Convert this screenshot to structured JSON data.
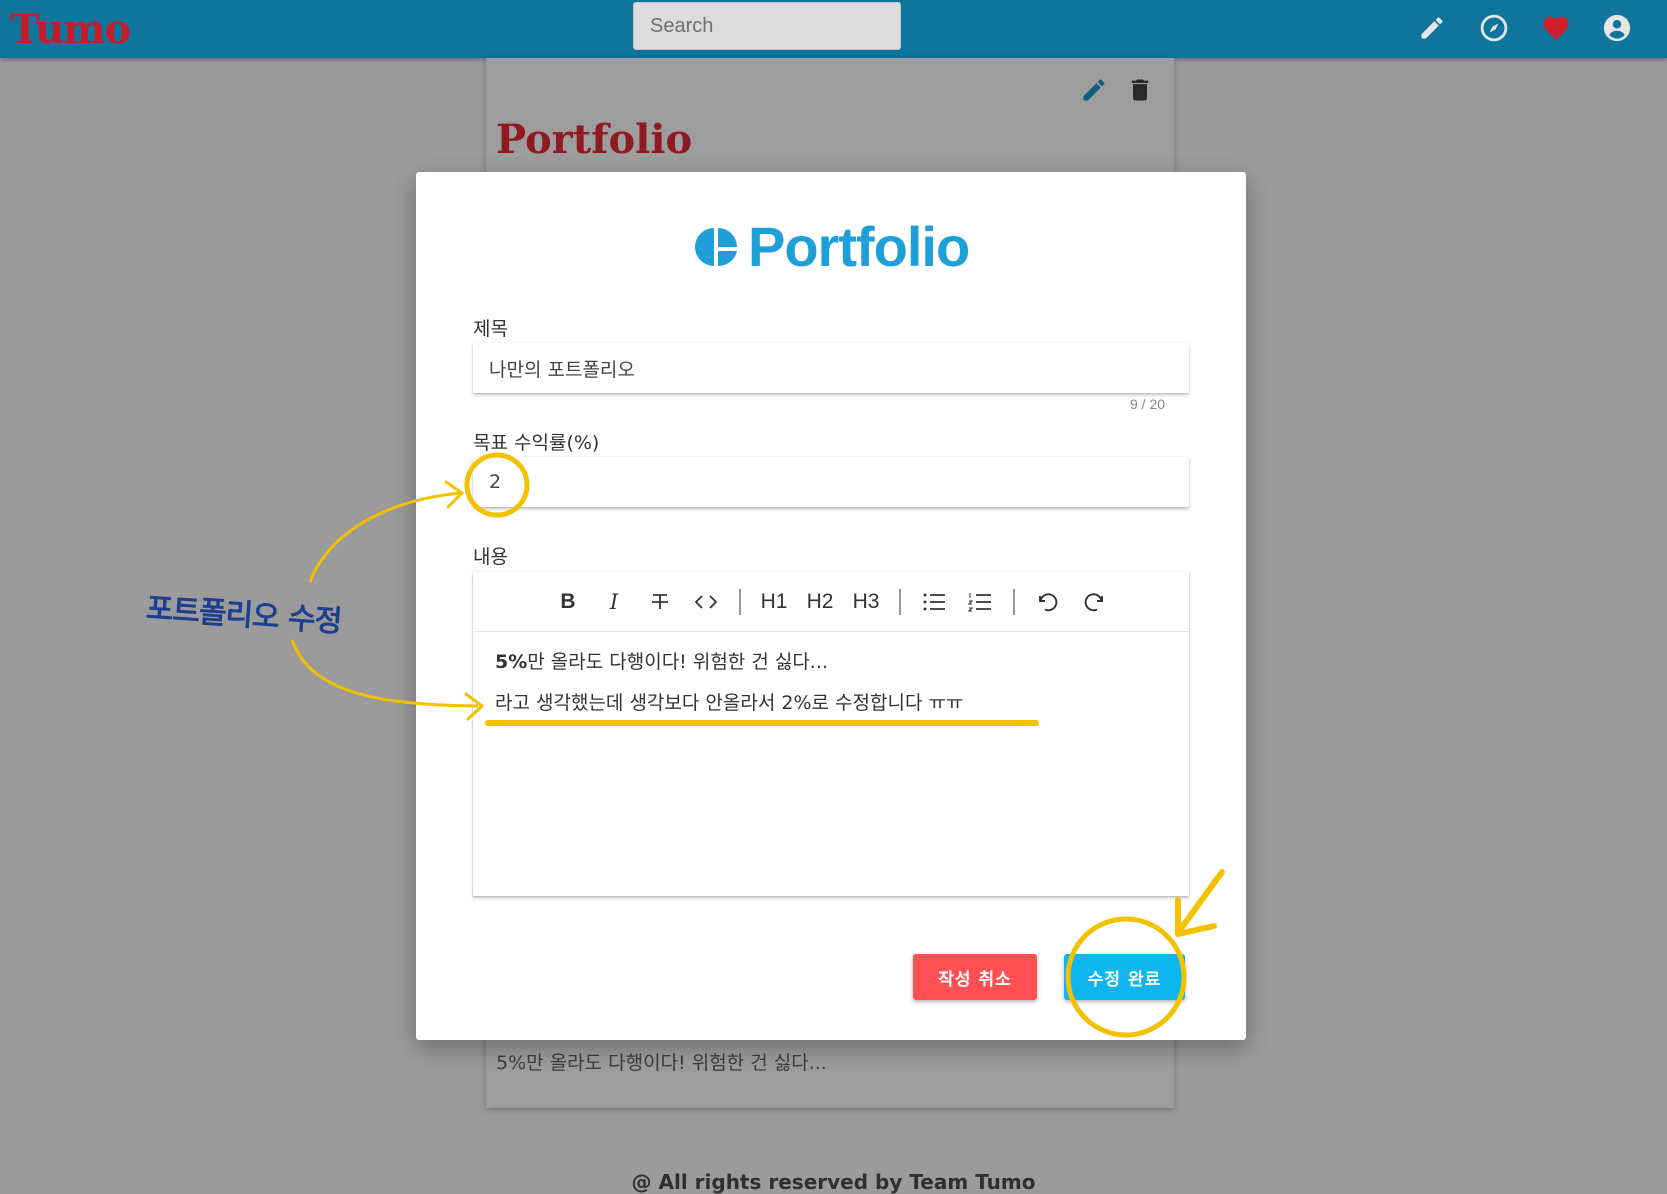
{
  "topbar": {
    "logo": "Tumo",
    "search_placeholder": "Search",
    "icons": [
      "pencil-icon",
      "compass-icon",
      "heart-icon",
      "account-circle-icon"
    ],
    "colors": {
      "bar": "#0f759c",
      "logo": "#c41c2a",
      "heart": "#d21f2b"
    }
  },
  "background_card": {
    "title": "Portfolio",
    "content_preview": "5%만 올라도 다행이다! 위험한 건 싫다...",
    "icons": [
      "edit-icon",
      "trash-icon"
    ]
  },
  "modal": {
    "logo_text": "Portfolio",
    "title_label": "제목",
    "title_value": "나만의 포트폴리오",
    "title_counter": "9 / 20",
    "target_label": "목표 수익률(%)",
    "target_value": "2",
    "content_label": "내용",
    "toolbar": [
      "B",
      "I",
      "strikethrough",
      "code",
      "H1",
      "H2",
      "H3",
      "bullet-list",
      "ordered-list",
      "undo",
      "redo"
    ],
    "content_line1_bold": "5%",
    "content_line1_rest": "만 올라도 다행이다! 위험한 건 싫다...",
    "content_line2": "라고 생각했는데 생각보다 안올라서 2%로 수정합니다 ㅠㅠ",
    "cancel_label": "작성 취소",
    "submit_label": "수정 완료",
    "colors": {
      "accent": "#1e9fd8",
      "cancel": "#ff5054",
      "submit": "#0db6ef"
    }
  },
  "annotation": {
    "text": "포트폴리오 수정",
    "color": "#f2c200"
  },
  "footer": {
    "text": "@ All rights reserved by Team Tumo"
  }
}
